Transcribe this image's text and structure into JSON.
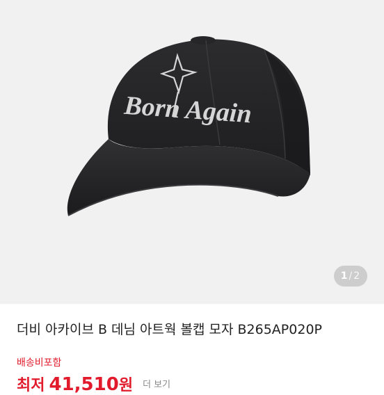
{
  "product": {
    "image_alt": "black denim baseball cap with embroidered Born Again lettering",
    "cap_text": "Born Again",
    "pager": {
      "current": "1",
      "separator": "/",
      "total": "2"
    },
    "title": "더비 아카이브 B 데님 아트웍 볼캡 모자 B265AP020P",
    "shipping": "배송비포함",
    "price": {
      "label": "최저",
      "amount": "41,510",
      "unit": "원",
      "more": "더 보기"
    }
  },
  "colors": {
    "accent": "#e21b2c",
    "cap": "#232325",
    "embroidery": "#d6d6d6",
    "gallery_bg": "#f1f1f1"
  }
}
